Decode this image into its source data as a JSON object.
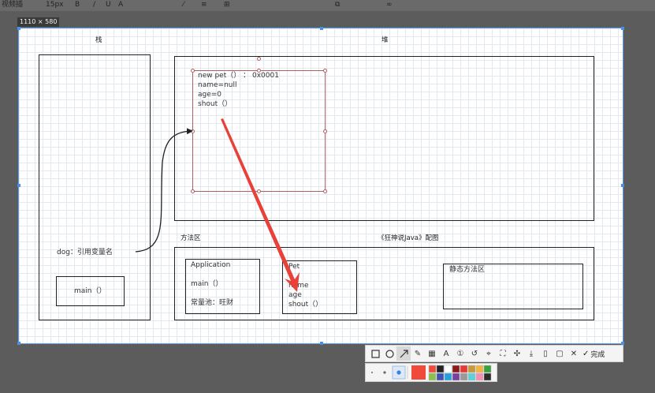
{
  "topbar": {
    "left_text": "视频插",
    "size_text": "15px"
  },
  "capture_size_label": "1110 × 580",
  "diagram": {
    "stack_title": "栈",
    "heap_title": "堆",
    "heap_object": {
      "line1": "new pet（）   ：  0x0001",
      "line2": "name=null",
      "line3": "age=0",
      "line4": "shout（）"
    },
    "method_area_title": "方法区",
    "credit": "《狂神说Java》配图",
    "dog_ref": "dog：引用变量名",
    "main_frame": "main（）",
    "application_class": {
      "line1": "Application",
      "line2": "main（）",
      "line3": "常量池：旺财"
    },
    "pet_class": {
      "line1": "Pet",
      "line2": "name",
      "line3": "age",
      "line4": "shout（）"
    },
    "static_area": "静态方法区"
  },
  "toolbar": {
    "icons": [
      "rectangle-icon",
      "ellipse-icon",
      "arrow-icon",
      "pen-icon",
      "mosaic-icon",
      "text-icon",
      "number-icon",
      "undo-icon",
      "pin-icon",
      "ocr-icon",
      "translate-icon",
      "save-icon",
      "long-capture-icon",
      "record-icon",
      "close-icon"
    ],
    "done_label": "完成"
  },
  "palette": {
    "selected_color": "#f04a3a",
    "colors": [
      "#f04a3a",
      "#222222",
      "#ffffff",
      "#8c1a1a",
      "#e53935",
      "#c69a3b",
      "#f3b33d",
      "#3aa040",
      "#8bc34a",
      "#3f51b5",
      "#26a0da",
      "#7b3fa0",
      "#999999",
      "#5dd0dd",
      "#f48fb1",
      "#2c2c2c"
    ]
  }
}
